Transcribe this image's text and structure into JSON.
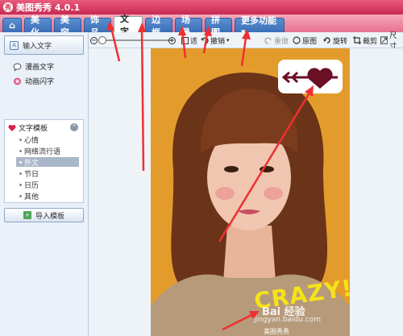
{
  "app": {
    "title": "美图秀秀 4.0.1",
    "logo_glyph": "秀"
  },
  "tabs": [
    {
      "label": "⌂",
      "name": "home",
      "active": false
    },
    {
      "label": "美化",
      "name": "beautify",
      "active": false
    },
    {
      "label": "美容",
      "name": "beauty",
      "active": false
    },
    {
      "label": "饰品",
      "name": "accessories",
      "active": false
    },
    {
      "label": "文字",
      "name": "text",
      "active": true
    },
    {
      "label": "边框",
      "name": "frame",
      "active": false
    },
    {
      "label": "场景",
      "name": "scene",
      "active": false
    },
    {
      "label": "拼图",
      "name": "collage",
      "active": false
    },
    {
      "label": "更多功能 ▾",
      "name": "more",
      "active": false
    }
  ],
  "left": {
    "input_text_label": "输入文字",
    "comic_text_label": "漫画文字",
    "animated_text_label": "动画闪字",
    "template_label": "文字模板",
    "template_items": [
      {
        "label": "心情",
        "selected": false
      },
      {
        "label": "网络流行语",
        "selected": false
      },
      {
        "label": "外文",
        "selected": true
      },
      {
        "label": "节日",
        "selected": false
      },
      {
        "label": "日历",
        "selected": false
      },
      {
        "label": "其他",
        "selected": false
      }
    ],
    "collapse_glyph": "^",
    "import_label": "导入模板"
  },
  "toolbar": {
    "fit_label": "适",
    "undo_label": "撤销",
    "redo_label": "重做",
    "original_label": "原图",
    "rotate_label": "旋转",
    "crop_label": "裁剪",
    "size_label": "尺寸"
  },
  "photo": {
    "crazy_text": "CRAZY!",
    "watermark_1": "Bai 经验",
    "watermark_2": "jingyan.baidu.com",
    "corner_text": "美图秀秀"
  },
  "colors": {
    "accent_pink": "#e0406a",
    "tab_blue": "#4a80c4",
    "annotation_red": "#ee3030",
    "photo_bg": "#e29a2a"
  }
}
